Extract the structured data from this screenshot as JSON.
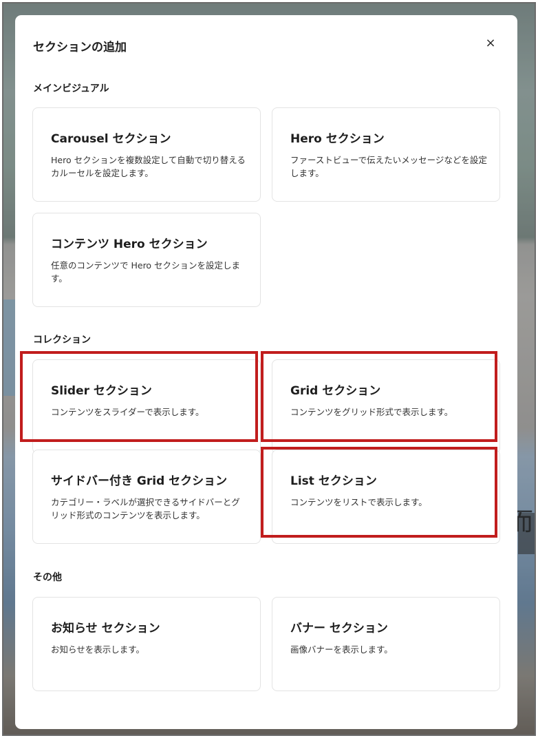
{
  "modal": {
    "title": "セクションの追加",
    "close_icon": "close-icon",
    "close_glyph": "×"
  },
  "sections": [
    {
      "label": "メインビジュアル",
      "cards": [
        {
          "title": "Carousel セクション",
          "desc": "Hero セクションを複数設定して自動で切り替えるカルーセルを設定します。"
        },
        {
          "title": "Hero セクション",
          "desc": "ファーストビューで伝えたいメッセージなどを設定します。"
        },
        {
          "title": "コンテンツ Hero セクション",
          "desc": "任意のコンテンツで Hero セクションを設定します。"
        }
      ]
    },
    {
      "label": "コレクション",
      "cards": [
        {
          "title": "Slider セクション",
          "desc": "コンテンツをスライダーで表示します。"
        },
        {
          "title": "Grid セクション",
          "desc": "コンテンツをグリッド形式で表示します。"
        },
        {
          "title": "サイドバー付き Grid セクション",
          "desc": "カテゴリー・ラベルが選択できるサイドバーとグリッド形式のコンテンツを表示します。"
        },
        {
          "title": "List セクション",
          "desc": "コンテンツをリストで表示します。"
        }
      ]
    },
    {
      "label": "その他",
      "cards": [
        {
          "title": "お知らせ セクション",
          "desc": "お知らせを表示します。"
        },
        {
          "title": "バナー セクション",
          "desc": "画像バナーを表示します。"
        }
      ]
    }
  ],
  "background": {
    "glyph": "而"
  },
  "colors": {
    "highlight": "#c11d1d",
    "card_border": "#e3e3e3",
    "modal_bg": "#ffffff"
  }
}
